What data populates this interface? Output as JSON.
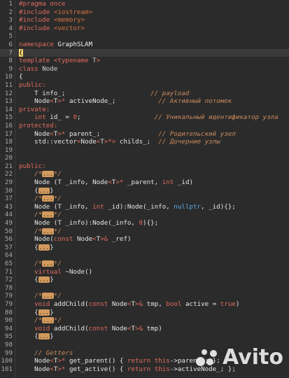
{
  "lines": [
    {
      "n": "1",
      "seg": [
        [
          "t-dir",
          "#pragma once"
        ]
      ]
    },
    {
      "n": "2",
      "seg": [
        [
          "t-dir",
          "#include "
        ],
        [
          "t-hdr",
          "<iostream>"
        ]
      ]
    },
    {
      "n": "3",
      "seg": [
        [
          "t-dir",
          "#include "
        ],
        [
          "t-hdr",
          "<memory>"
        ]
      ]
    },
    {
      "n": "4",
      "seg": [
        [
          "t-dir",
          "#include "
        ],
        [
          "t-hdr",
          "<vector>"
        ]
      ]
    },
    {
      "n": "5",
      "seg": []
    },
    {
      "n": "6",
      "seg": [
        [
          "t-kw",
          "namespace "
        ],
        [
          "t-ns",
          "GraphSLAM"
        ]
      ]
    },
    {
      "n": "7",
      "hl": true,
      "seg": [
        [
          "caret",
          "{"
        ]
      ]
    },
    {
      "n": "8",
      "seg": [
        [
          "t-kw",
          "template "
        ],
        [
          "t-tmpl",
          "<"
        ],
        [
          "t-kw",
          "typename "
        ],
        [
          "t-type",
          "T"
        ],
        [
          "t-tmpl",
          ">"
        ]
      ]
    },
    {
      "n": "9",
      "seg": [
        [
          "t-kw",
          "class "
        ],
        [
          "t-type",
          "Node"
        ]
      ]
    },
    {
      "n": "10",
      "seg": [
        [
          "t-brace",
          "{"
        ]
      ]
    },
    {
      "n": "11",
      "seg": [
        [
          "t-kw",
          "public:"
        ]
      ]
    },
    {
      "n": "12",
      "seg": [
        [
          "",
          "    T info_;                      "
        ],
        [
          "t-cmt",
          "// payload"
        ]
      ]
    },
    {
      "n": "13",
      "seg": [
        [
          "",
          "    Node"
        ],
        [
          "t-tmpl",
          "<"
        ],
        [
          "",
          "T"
        ],
        [
          "t-tmpl",
          ">* "
        ],
        [
          "",
          "activeNode_;           "
        ],
        [
          "t-cmt",
          "// Активный потомок"
        ]
      ]
    },
    {
      "n": "14",
      "seg": [
        [
          "t-kw",
          "private:"
        ]
      ]
    },
    {
      "n": "15",
      "seg": [
        [
          "",
          "    "
        ],
        [
          "t-kw",
          "int "
        ],
        [
          "",
          "id_ = "
        ],
        [
          "t-num",
          "0"
        ],
        [
          "",
          ";                   "
        ],
        [
          "t-cmt",
          "// Уникальный идентификатор узла"
        ]
      ]
    },
    {
      "n": "16",
      "seg": [
        [
          "t-kw",
          "protected:"
        ]
      ]
    },
    {
      "n": "17",
      "seg": [
        [
          "",
          "    Node"
        ],
        [
          "t-tmpl",
          "<"
        ],
        [
          "",
          "T"
        ],
        [
          "t-tmpl",
          ">* "
        ],
        [
          "",
          "parent_;               "
        ],
        [
          "t-cmt",
          "// Родительский узел"
        ]
      ]
    },
    {
      "n": "18",
      "seg": [
        [
          "",
          "    std::vector"
        ],
        [
          "t-tmpl",
          "<"
        ],
        [
          "",
          "Node"
        ],
        [
          "t-tmpl",
          "<"
        ],
        [
          "",
          "T"
        ],
        [
          "t-tmpl",
          ">*> "
        ],
        [
          "",
          "childs_;  "
        ],
        [
          "t-cmt",
          "// Дочерние узлы"
        ]
      ]
    },
    {
      "n": "19",
      "seg": []
    },
    {
      "n": "20",
      "seg": []
    },
    {
      "n": "21",
      "seg": [
        [
          "t-kw",
          "public:"
        ]
      ]
    },
    {
      "n": "22",
      "seg": [
        [
          "",
          "    "
        ],
        [
          "t-cmt",
          "/*"
        ],
        [
          "t-fold",
          "..."
        ],
        [
          "t-cmt",
          "*/"
        ]
      ]
    },
    {
      "n": "29",
      "seg": [
        [
          "",
          "    Node (T _info, Node"
        ],
        [
          "t-tmpl",
          "<"
        ],
        [
          "",
          "T"
        ],
        [
          "t-tmpl",
          ">* "
        ],
        [
          "",
          "_parent, "
        ],
        [
          "t-kw",
          "int "
        ],
        [
          "",
          "_id)"
        ]
      ]
    },
    {
      "n": "30",
      "seg": [
        [
          "",
          "    {"
        ],
        [
          "t-fold",
          "..."
        ],
        [
          "",
          "}"
        ]
      ]
    },
    {
      "n": "37",
      "seg": [
        [
          "",
          "    "
        ],
        [
          "t-cmt",
          "/*"
        ],
        [
          "t-fold",
          "..."
        ],
        [
          "t-cmt",
          "*/"
        ]
      ]
    },
    {
      "n": "43",
      "seg": [
        [
          "",
          "    Node (T _info, "
        ],
        [
          "t-kw",
          "int "
        ],
        [
          "",
          "_id):Node(_info, "
        ],
        [
          "t-null",
          "nullptr"
        ],
        [
          "",
          ", _id){};"
        ]
      ]
    },
    {
      "n": "44",
      "seg": [
        [
          "",
          "    "
        ],
        [
          "t-cmt",
          "/*"
        ],
        [
          "t-fold",
          "..."
        ],
        [
          "t-cmt",
          "*/"
        ]
      ]
    },
    {
      "n": "49",
      "seg": [
        [
          "",
          "    Node (T _info):Node(_info, "
        ],
        [
          "t-num",
          "0"
        ],
        [
          "",
          "){};"
        ]
      ]
    },
    {
      "n": "50",
      "seg": [
        [
          "",
          "    "
        ],
        [
          "t-cmt",
          "/*"
        ],
        [
          "t-fold",
          "..."
        ],
        [
          "t-cmt",
          "*/"
        ]
      ]
    },
    {
      "n": "56",
      "seg": [
        [
          "",
          "    Node("
        ],
        [
          "t-kw",
          "const "
        ],
        [
          "",
          "Node"
        ],
        [
          "t-tmpl",
          "<"
        ],
        [
          "",
          "T"
        ],
        [
          "t-tmpl",
          ">& "
        ],
        [
          "",
          "_ref)"
        ]
      ]
    },
    {
      "n": "57",
      "seg": [
        [
          "",
          "    {"
        ],
        [
          "t-fold",
          "..."
        ],
        [
          "",
          "}"
        ]
      ]
    },
    {
      "n": "64",
      "seg": []
    },
    {
      "n": "65",
      "seg": [
        [
          "",
          "    "
        ],
        [
          "t-cmt",
          "/*"
        ],
        [
          "t-fold",
          "..."
        ],
        [
          "t-cmt",
          "*/"
        ]
      ]
    },
    {
      "n": "71",
      "seg": [
        [
          "",
          "    "
        ],
        [
          "t-kw",
          "virtual "
        ],
        [
          "",
          "~Node()"
        ]
      ]
    },
    {
      "n": "72",
      "seg": [
        [
          "",
          "    {"
        ],
        [
          "t-fold",
          "..."
        ],
        [
          "",
          "}"
        ]
      ]
    },
    {
      "n": "78",
      "seg": []
    },
    {
      "n": "79",
      "seg": [
        [
          "",
          "    "
        ],
        [
          "t-cmt",
          "/*"
        ],
        [
          "t-fold",
          "..."
        ],
        [
          "t-cmt",
          "*/"
        ]
      ]
    },
    {
      "n": "79",
      "seg": [
        [
          "",
          "    "
        ],
        [
          "t-kw",
          "void "
        ],
        [
          "",
          "addChild("
        ],
        [
          "t-kw",
          "const "
        ],
        [
          "",
          "Node"
        ],
        [
          "t-tmpl",
          "<"
        ],
        [
          "",
          "T"
        ],
        [
          "t-tmpl",
          ">& "
        ],
        [
          "",
          "tmp, "
        ],
        [
          "t-kw",
          "bool "
        ],
        [
          "",
          "active = "
        ],
        [
          "t-kw",
          "true"
        ],
        [
          "",
          ")"
        ]
      ]
    },
    {
      "n": "80",
      "seg": [
        [
          "",
          "    {"
        ],
        [
          "t-fold",
          "..."
        ],
        [
          "",
          "}"
        ]
      ]
    },
    {
      "n": "90",
      "seg": [
        [
          "",
          "    "
        ],
        [
          "t-cmt",
          "/*"
        ],
        [
          "t-fold",
          "..."
        ],
        [
          "t-cmt",
          "*/"
        ]
      ]
    },
    {
      "n": "94",
      "seg": [
        [
          "",
          "    "
        ],
        [
          "t-kw",
          "void "
        ],
        [
          "",
          "addChild("
        ],
        [
          "t-kw",
          "const "
        ],
        [
          "",
          "Node"
        ],
        [
          "t-tmpl",
          "<"
        ],
        [
          "",
          "T"
        ],
        [
          "t-tmpl",
          ">& "
        ],
        [
          "",
          "tmp)"
        ]
      ]
    },
    {
      "n": "95",
      "seg": [
        [
          "",
          "    {"
        ],
        [
          "t-fold",
          "..."
        ],
        [
          "",
          "}"
        ]
      ]
    },
    {
      "n": "98",
      "seg": []
    },
    {
      "n": "99",
      "seg": [
        [
          "",
          "    "
        ],
        [
          "t-cmt",
          "// Getters"
        ]
      ]
    },
    {
      "n": "100",
      "seg": [
        [
          "",
          "    Node"
        ],
        [
          "t-tmpl",
          "<"
        ],
        [
          "",
          "T"
        ],
        [
          "t-tmpl",
          ">* "
        ],
        [
          "",
          "get_parent() { "
        ],
        [
          "t-kw",
          "return "
        ],
        [
          "t-kw",
          "this"
        ],
        [
          "",
          "->parent_; };"
        ]
      ]
    },
    {
      "n": "101",
      "seg": [
        [
          "",
          "    Node"
        ],
        [
          "t-tmpl",
          "<"
        ],
        [
          "",
          "T"
        ],
        [
          "t-tmpl",
          ">* "
        ],
        [
          "",
          "get_active() { "
        ],
        [
          "t-kw",
          "return "
        ],
        [
          "t-kw",
          "this"
        ],
        [
          "",
          "->activeNode_; };"
        ]
      ]
    }
  ],
  "watermark": "Avito"
}
